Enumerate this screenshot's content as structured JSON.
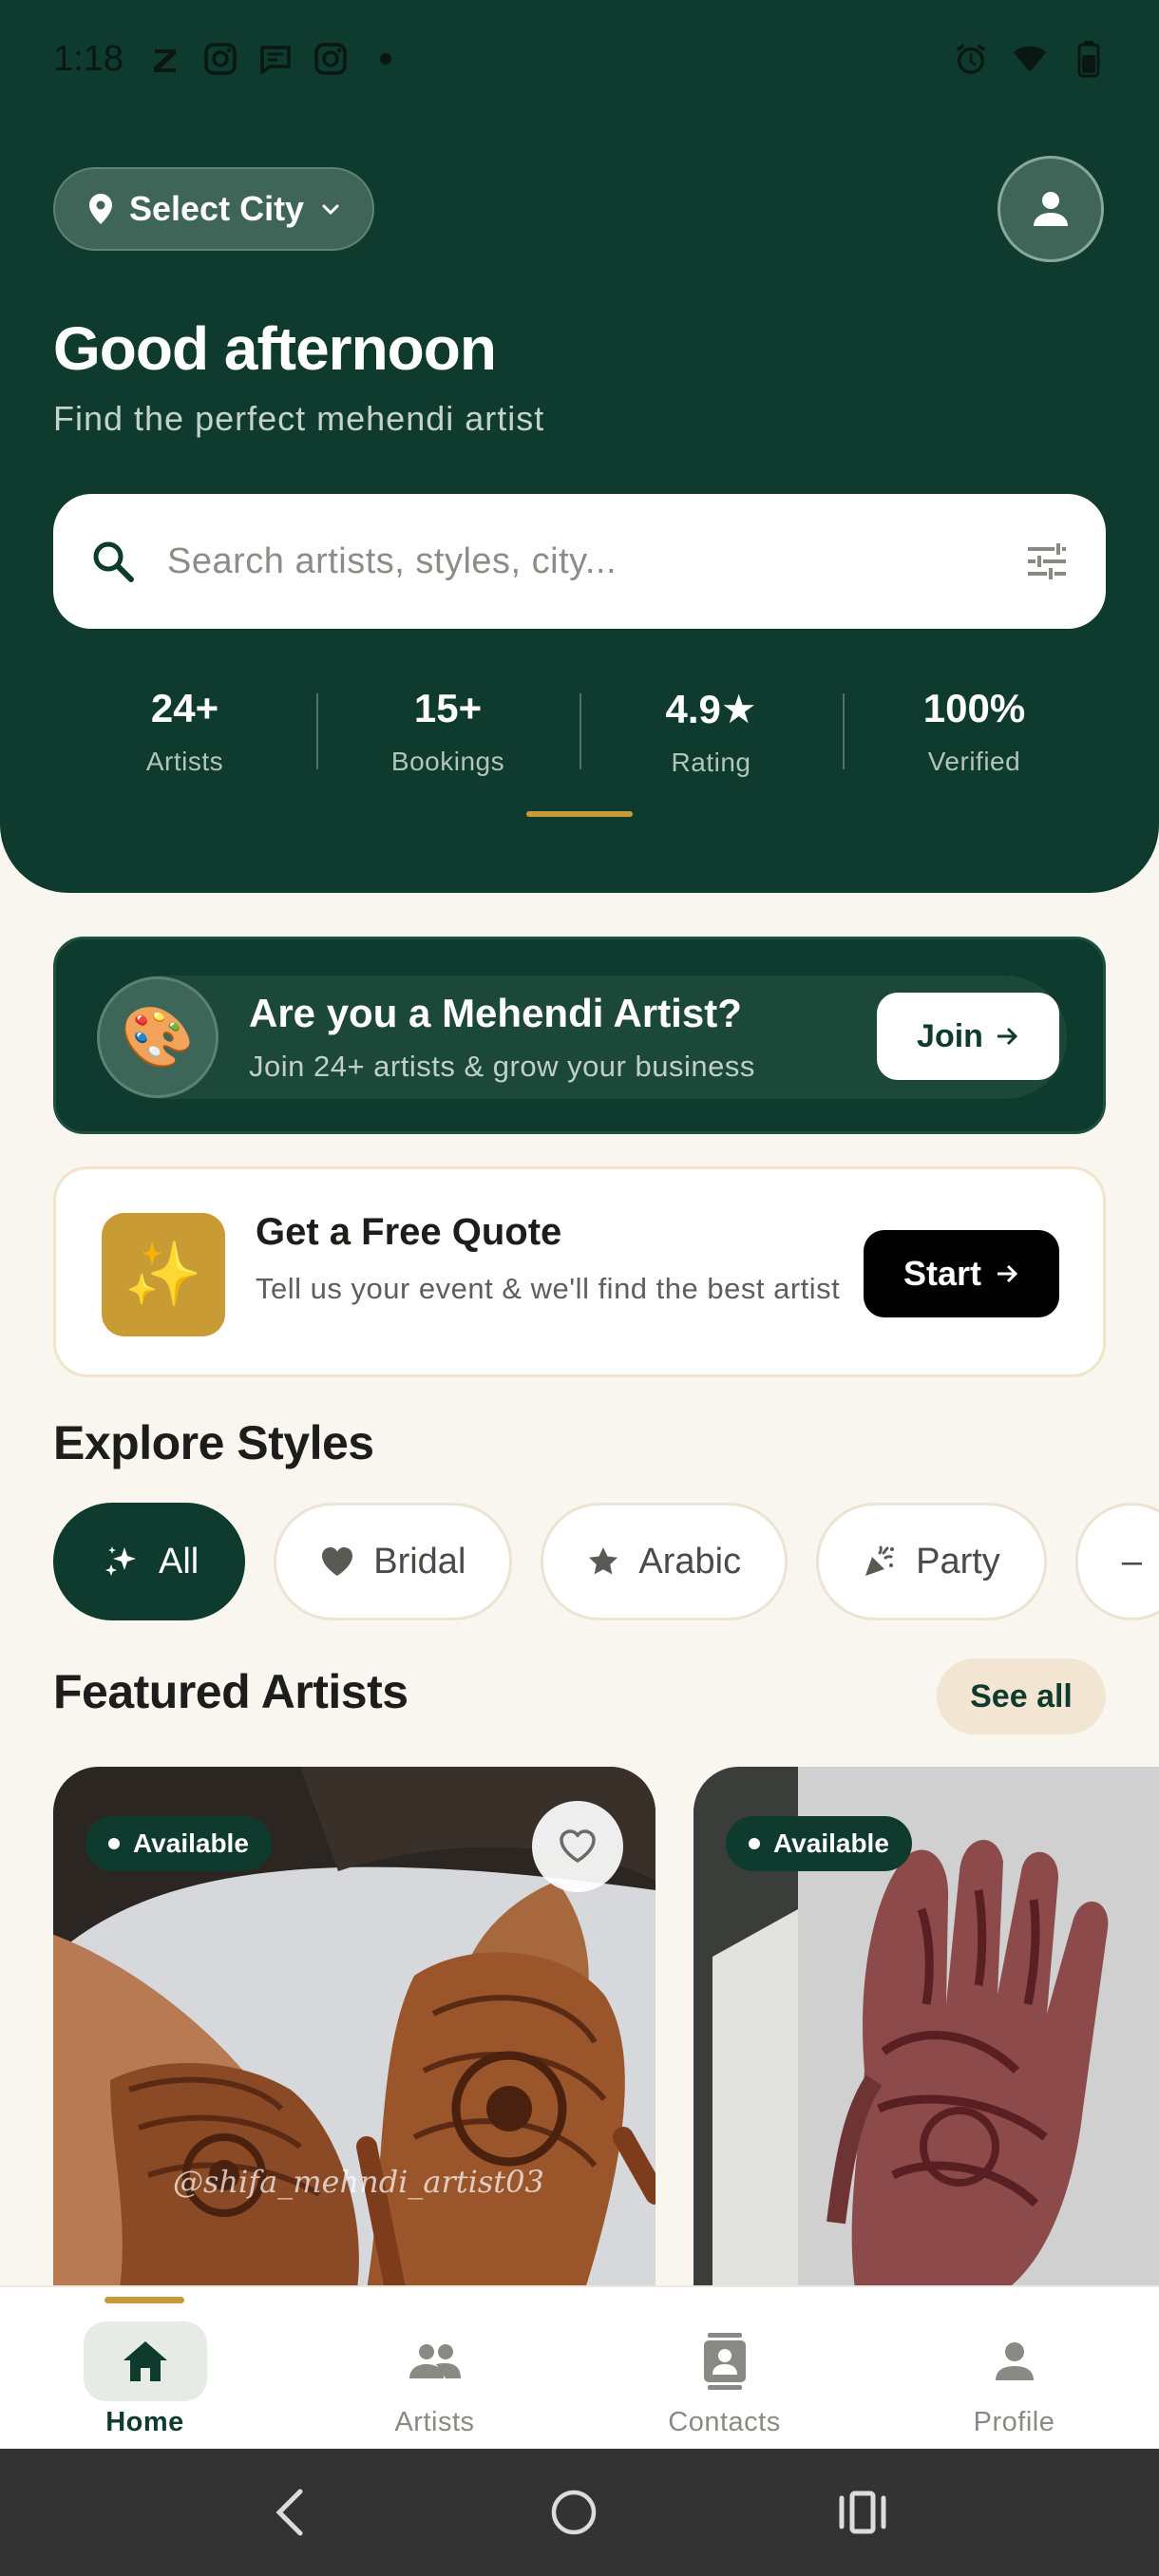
{
  "status_bar": {
    "time": "1:18"
  },
  "header": {
    "city_label": "Select City",
    "greeting": "Good afternoon",
    "subtitle": "Find the perfect mehendi artist",
    "search_placeholder": "Search artists, styles, city...",
    "stats": [
      {
        "value": "24+",
        "label": "Artists"
      },
      {
        "value": "15+",
        "label": "Bookings"
      },
      {
        "value": "4.9★",
        "label": "Rating"
      },
      {
        "value": "100%",
        "label": "Verified"
      }
    ]
  },
  "artist_banner": {
    "icon": "🎨",
    "title": "Are you a Mehendi Artist?",
    "subtitle": "Join 24+ artists & grow your business",
    "button_label": "Join"
  },
  "quote_card": {
    "icon": "✨",
    "title": "Get a Free Quote",
    "subtitle": "Tell us your event & we'll find the best artist",
    "button_label": "Start"
  },
  "explore": {
    "title": "Explore Styles",
    "chips": [
      {
        "label": "All",
        "icon": "sparkle-icon",
        "active": true
      },
      {
        "label": "Bridal",
        "icon": "heart-icon"
      },
      {
        "label": "Arabic",
        "icon": "star-icon"
      },
      {
        "label": "Party",
        "icon": "party-popper-icon"
      },
      {
        "label": "–",
        "icon": ""
      }
    ]
  },
  "featured": {
    "title": "Featured Artists",
    "see_all_label": "See all",
    "cards": [
      {
        "badge": "Available",
        "watermark": "@shifa_mehndi_artist03"
      },
      {
        "badge": "Available"
      }
    ]
  },
  "bottom_nav": {
    "items": [
      {
        "label": "Home",
        "icon": "home-icon",
        "active": true
      },
      {
        "label": "Artists",
        "icon": "people-icon"
      },
      {
        "label": "Contacts",
        "icon": "contacts-icon"
      },
      {
        "label": "Profile",
        "icon": "person-icon"
      }
    ]
  },
  "colors": {
    "primary": "#0e3b2e",
    "accent_gold": "#c99b38",
    "background": "#f9f6f0"
  }
}
